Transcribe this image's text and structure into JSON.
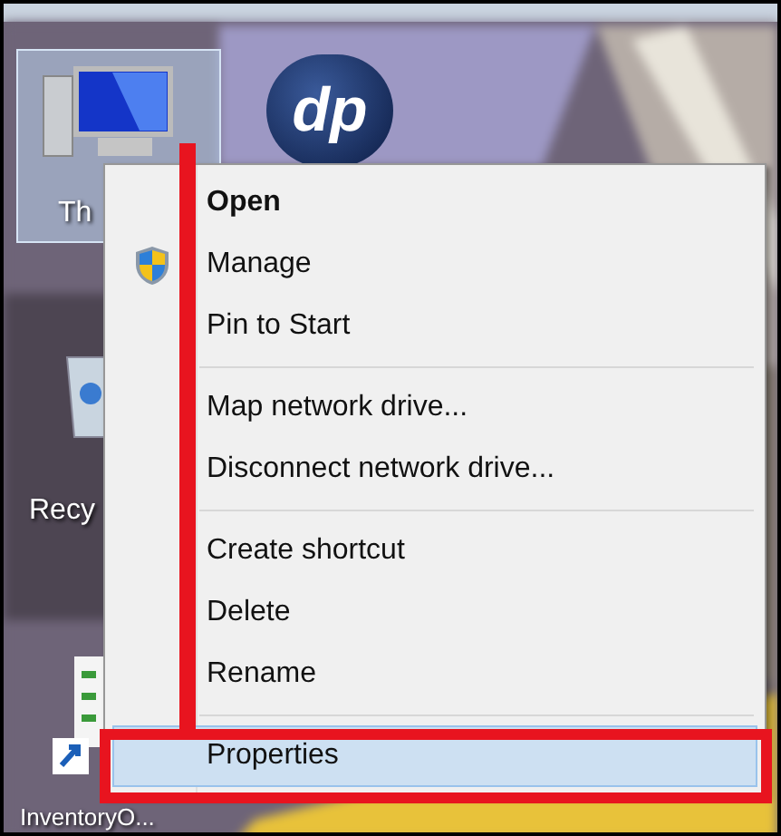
{
  "desktop": {
    "logo_text": "dp",
    "icons": [
      {
        "kind": "computer",
        "label": "Th",
        "selected": true
      },
      {
        "kind": "recycle",
        "label": "Recy",
        "selected": false
      },
      {
        "kind": "shortcut",
        "label": "InventoryO...",
        "selected": false
      }
    ]
  },
  "context_menu": {
    "groups": [
      [
        {
          "label": "Open",
          "default": true,
          "admin": false,
          "selected": false
        },
        {
          "label": "Manage",
          "default": false,
          "admin": true,
          "selected": false
        },
        {
          "label": "Pin to Start",
          "default": false,
          "admin": false,
          "selected": false
        }
      ],
      [
        {
          "label": "Map network drive...",
          "default": false,
          "admin": false,
          "selected": false
        },
        {
          "label": "Disconnect network drive...",
          "default": false,
          "admin": false,
          "selected": false
        }
      ],
      [
        {
          "label": "Create shortcut",
          "default": false,
          "admin": false,
          "selected": false
        },
        {
          "label": "Delete",
          "default": false,
          "admin": false,
          "selected": false
        },
        {
          "label": "Rename",
          "default": false,
          "admin": false,
          "selected": false
        }
      ],
      [
        {
          "label": "Properties",
          "default": false,
          "admin": false,
          "selected": true
        }
      ]
    ]
  }
}
